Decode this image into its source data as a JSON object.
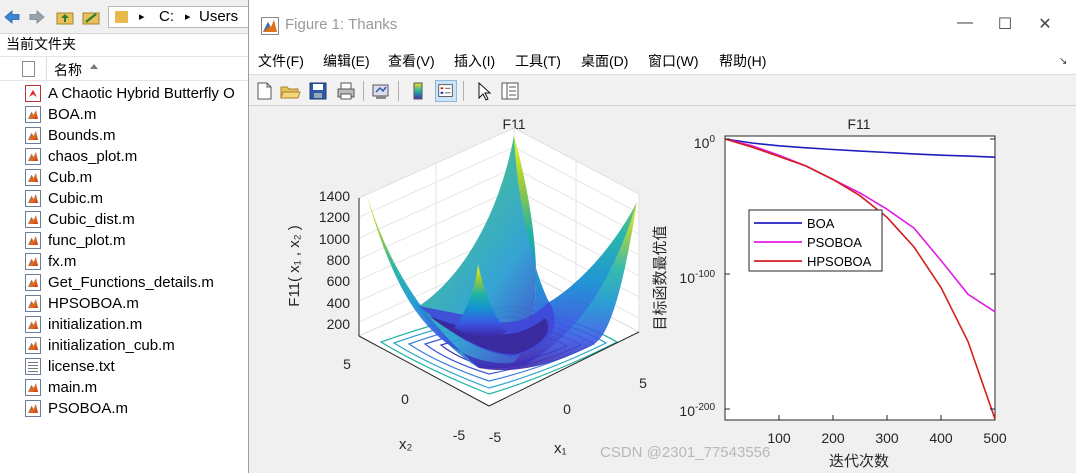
{
  "left_panel": {
    "address": {
      "drive": "C:",
      "folder": "Users",
      "sep": "▸"
    },
    "section_title": "当前文件夹",
    "column_header": "名称",
    "files": [
      {
        "name": "A Chaotic Hybrid Butterfly O",
        "type": "pdf"
      },
      {
        "name": "BOA.m",
        "type": "m"
      },
      {
        "name": "Bounds.m",
        "type": "m"
      },
      {
        "name": "chaos_plot.m",
        "type": "m"
      },
      {
        "name": "Cub.m",
        "type": "m"
      },
      {
        "name": "Cubic.m",
        "type": "m"
      },
      {
        "name": "Cubic_dist.m",
        "type": "m"
      },
      {
        "name": "func_plot.m",
        "type": "m"
      },
      {
        "name": "fx.m",
        "type": "m"
      },
      {
        "name": "Get_Functions_details.m",
        "type": "m"
      },
      {
        "name": "HPSOBOA.m",
        "type": "m"
      },
      {
        "name": "initialization.m",
        "type": "m"
      },
      {
        "name": "initialization_cub.m",
        "type": "m"
      },
      {
        "name": "license.txt",
        "type": "txt"
      },
      {
        "name": "main.m",
        "type": "m"
      },
      {
        "name": "PSOBOA.m",
        "type": "m"
      }
    ]
  },
  "figure": {
    "title": "Figure 1: Thanks",
    "window_buttons": {
      "minimize": "—",
      "maximize": "☐",
      "close": "✕"
    },
    "menus": [
      "文件(F)",
      "编辑(E)",
      "查看(V)",
      "插入(I)",
      "工具(T)",
      "桌面(D)",
      "窗口(W)",
      "帮助(H)"
    ]
  },
  "chart_data": [
    {
      "type": "surface",
      "title": "F11",
      "zlabel": "F11( x₁ , x₂ )",
      "xlabel": "x₁",
      "ylabel": "x₂",
      "z_ticks": [
        "200",
        "400",
        "600",
        "800",
        "1000",
        "1200",
        "1400"
      ],
      "x_ticks": [
        "-5",
        "0",
        "5"
      ],
      "y_ticks": [
        "5",
        "0",
        "-5"
      ],
      "zlim": [
        0,
        1400
      ],
      "grid": true,
      "colormap": "parula"
    },
    {
      "type": "line",
      "title": "F11",
      "xlabel": "迭代次数",
      "ylabel": "目标函数最优值",
      "yscale": "log",
      "xlim": [
        0,
        500
      ],
      "ylim_exponent": [
        -210,
        0
      ],
      "x_ticks": [
        "100",
        "200",
        "300",
        "400",
        "500"
      ],
      "y_ticks": [
        {
          "base": "10",
          "exp": "0"
        },
        {
          "base": "10",
          "exp": "-100"
        },
        {
          "base": "10",
          "exp": "-200"
        }
      ],
      "legend_position": "left-middle",
      "series": [
        {
          "name": "BOA",
          "color": "#1f1fbf",
          "x": [
            0,
            50,
            100,
            150,
            200,
            250,
            300,
            350,
            400,
            450,
            500
          ],
          "log10_y": [
            0,
            -3,
            -5,
            -6.5,
            -7.8,
            -9,
            -10,
            -11,
            -12,
            -12.7,
            -13.5
          ]
        },
        {
          "name": "PSOBOA",
          "color": "#e41ae4",
          "x": [
            0,
            50,
            100,
            150,
            200,
            250,
            300,
            350,
            400,
            450,
            500
          ],
          "log10_y": [
            0,
            -5,
            -12,
            -20,
            -30,
            -40,
            -52,
            -66,
            -90,
            -115,
            -128
          ]
        },
        {
          "name": "HPSOBOA",
          "color": "#d21e1e",
          "x": [
            0,
            50,
            100,
            150,
            200,
            250,
            300,
            350,
            400,
            450,
            500
          ],
          "log10_y": [
            0,
            -6,
            -13,
            -20,
            -30,
            -42,
            -58,
            -80,
            -110,
            -150,
            -208
          ]
        }
      ]
    }
  ],
  "watermark": "CSDN @2301_77543556"
}
